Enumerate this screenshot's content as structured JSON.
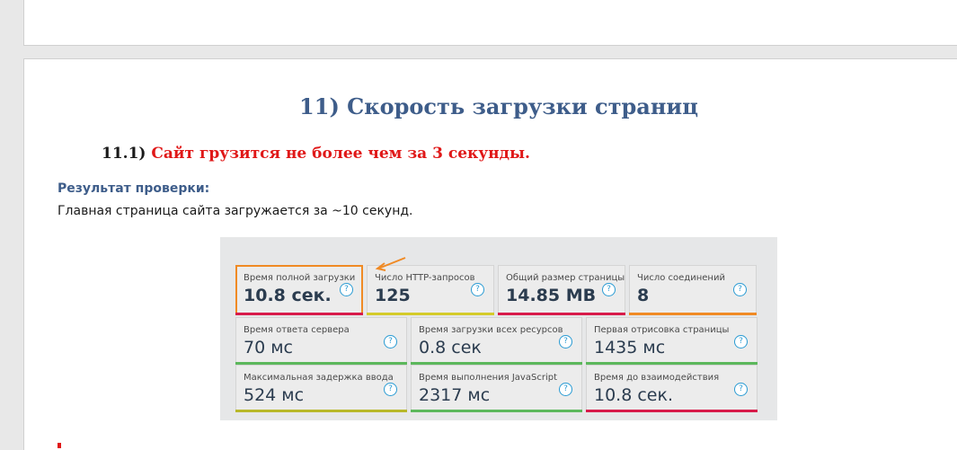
{
  "document": {
    "heading": "11) Скорость загрузки страниц",
    "subheading_number": "11.1)",
    "subheading_text": "Сайт грузится не более чем за 3 секунды.",
    "result_label": "Результат проверки:",
    "result_text": "Главная страница сайта загружается за ~10 секунд."
  },
  "metrics": {
    "help_symbol": "?",
    "row1": [
      {
        "label": "Время полной загрузки",
        "value": "10.8 сек.",
        "bar_color": "#d81b4a",
        "highlighted": true
      },
      {
        "label": "Число HTTP-запросов",
        "value": "125",
        "bar_color": "#d4cb2a"
      },
      {
        "label": "Общий размер страницы",
        "value": "14.85 MB",
        "bar_color": "#d81b4a"
      },
      {
        "label": "Число соединений",
        "value": "8",
        "bar_color": "#f08a24"
      }
    ],
    "row2": [
      {
        "label": "Время ответа сервера",
        "value": "70 мс",
        "bar_color": "#5cb85c"
      },
      {
        "label": "Время загрузки всех ресурсов",
        "value": "0.8 сек",
        "bar_color": "#5cb85c"
      },
      {
        "label": "Первая отрисовка страницы",
        "value": "1435 мс",
        "bar_color": "#5cb85c"
      }
    ],
    "row3": [
      {
        "label": "Максимальная задержка ввода",
        "value": "524 мс",
        "bar_color": "#b8b82a"
      },
      {
        "label": "Время выполнения JavaScript",
        "value": "2317 мс",
        "bar_color": "#5cb85c"
      },
      {
        "label": "Время до взаимодействия",
        "value": "10.8 сек.",
        "bar_color": "#d81b4a"
      }
    ],
    "annotation_arrow_color": "#f08a24"
  }
}
